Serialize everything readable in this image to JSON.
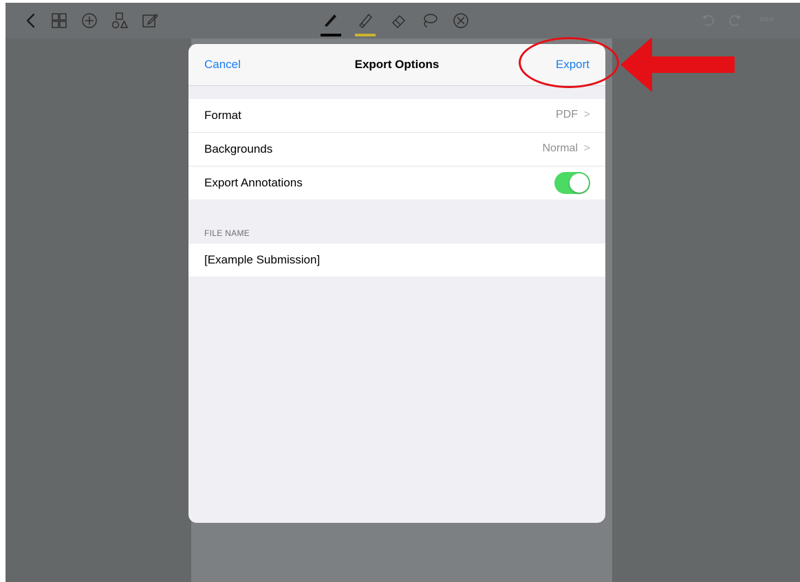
{
  "toolbar": {
    "left_icons": [
      "back-chevron-icon",
      "grid-icon",
      "add-circle-icon",
      "shapes-icon",
      "edit-icon"
    ],
    "center_icons": [
      "pen-icon",
      "highlighter-icon",
      "eraser-icon",
      "lasso-icon",
      "close-circle-icon"
    ],
    "right_icons": [
      "undo-icon",
      "redo-icon",
      "more-icon"
    ],
    "right_more_label": "ooo",
    "pen_color": "#000000",
    "highlighter_color": "#c8b232"
  },
  "modal": {
    "cancel_label": "Cancel",
    "title": "Export Options",
    "export_label": "Export",
    "rows": [
      {
        "label": "Format",
        "value": "PDF"
      },
      {
        "label": "Backgrounds",
        "value": "Normal"
      },
      {
        "label": "Export Annotations",
        "toggle": true
      }
    ],
    "file_section": {
      "header": "FILE NAME",
      "value": "[Example Submission]"
    }
  },
  "colors": {
    "accent": "#1a7cf0",
    "toggle_on": "#4cd964",
    "annotation_red": "#e50f16"
  }
}
